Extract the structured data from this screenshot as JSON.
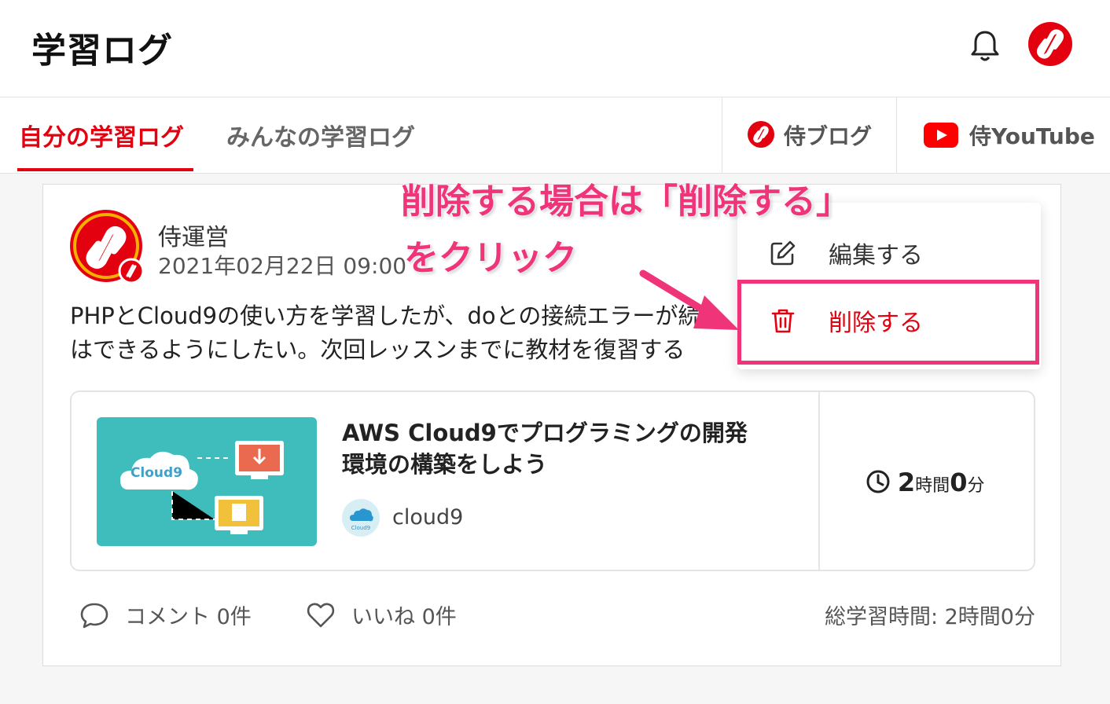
{
  "header": {
    "title": "学習ログ",
    "bell_icon": "bell-icon",
    "avatar_icon": "samurai-logo-icon"
  },
  "tabs": {
    "mine": "自分の学習ログ",
    "all": "みんなの学習ログ"
  },
  "external": {
    "blog": "侍ブログ",
    "youtube": "侍YouTube"
  },
  "post": {
    "author": "侍運営",
    "date": "2021年02月22日 09:00",
    "body_line1": "PHPとCloud9の使い方を学習したが、doとの接続エラーが続",
    "body_line2": "はできるようにしたい。次回レッスンまでに教材を復習する",
    "lesson": {
      "title_line1": "AWS Cloud9でプログラミングの開発",
      "title_line2": "環境の構築をしよう",
      "thumb_text": "Cloud9",
      "category_badge": "Cloud9",
      "category": "cloud9",
      "duration_hours": "2",
      "duration_hours_unit": "時間",
      "duration_minutes": "0",
      "duration_minutes_unit": "分"
    },
    "footer": {
      "comments": "コメント 0件",
      "likes": "いいね 0件",
      "total": "総学習時間: 2時間0分"
    }
  },
  "menu": {
    "edit": "編集する",
    "delete": "削除する"
  },
  "annotation": {
    "line1": "削除する場合は「削除する」",
    "line2": "をクリック"
  },
  "colors": {
    "accent": "#e3000f",
    "annotation": "#f0347a"
  }
}
